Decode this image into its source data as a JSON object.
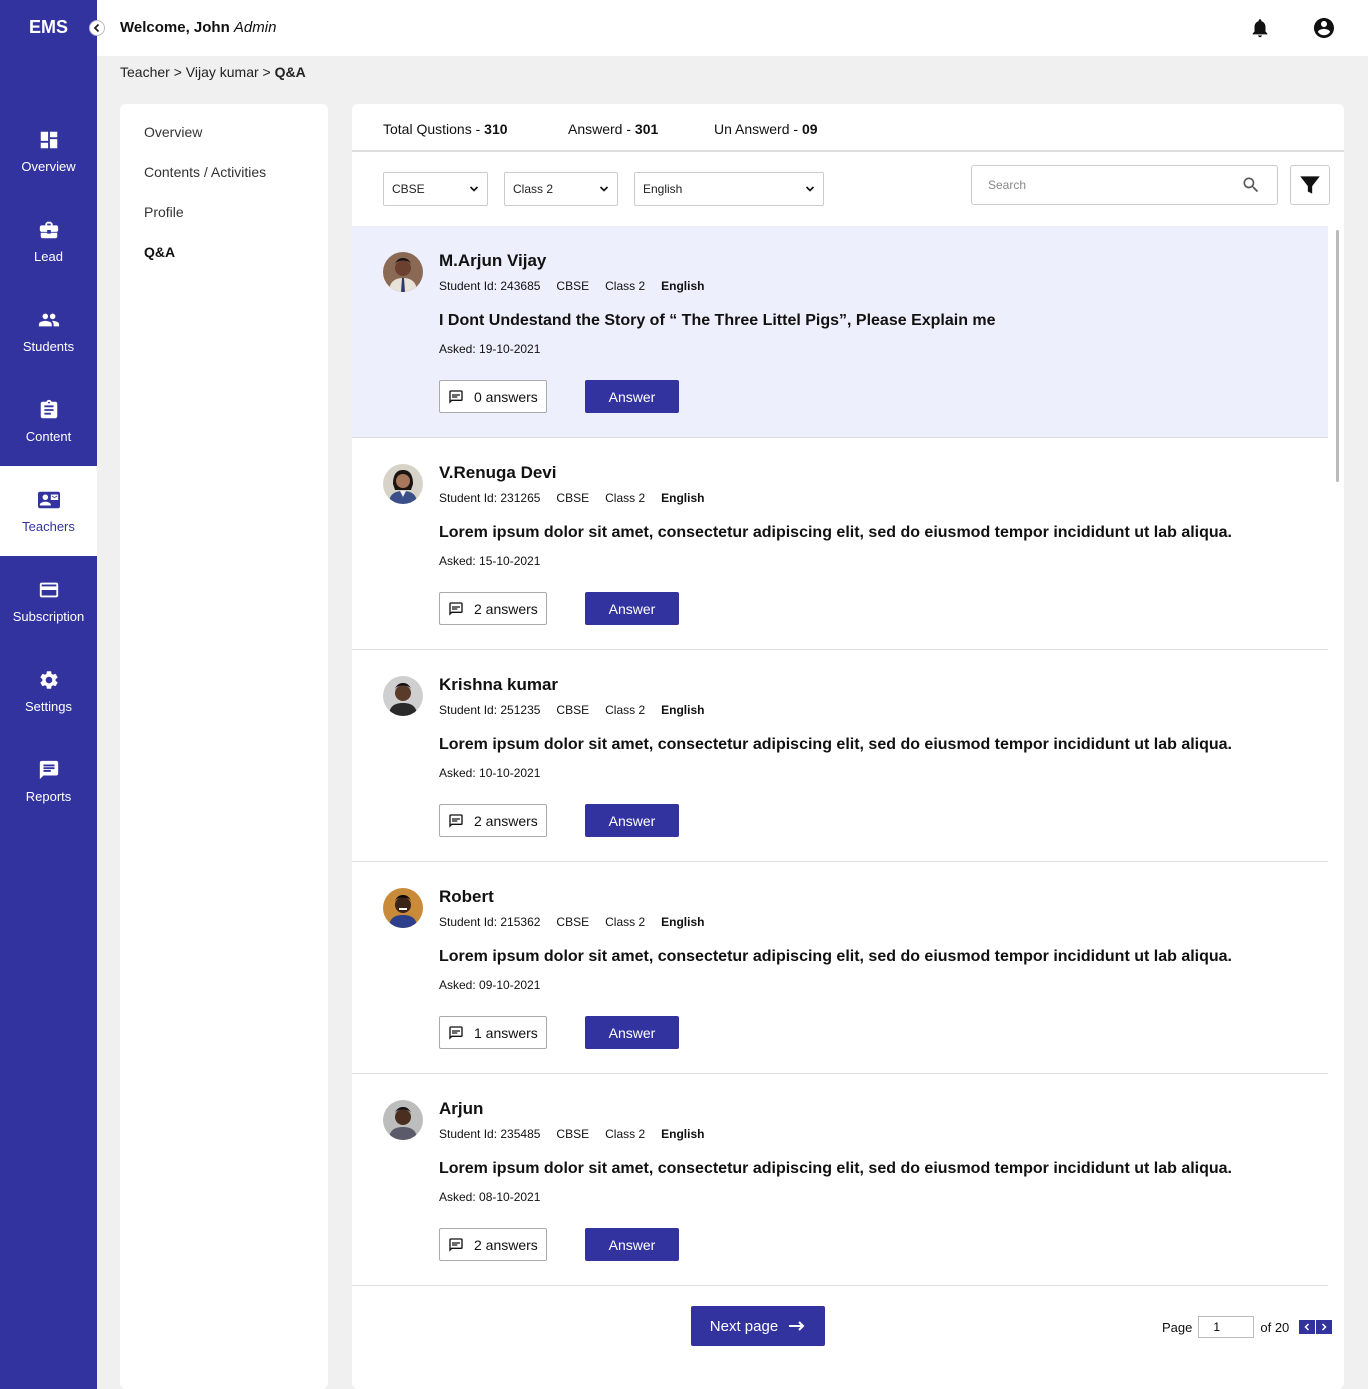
{
  "app": {
    "logo": "EMS"
  },
  "header": {
    "welcome": "Welcome, John",
    "role": "Admin"
  },
  "sidebar": {
    "items": [
      {
        "label": "Overview",
        "icon": "dashboard-icon"
      },
      {
        "label": "Lead",
        "icon": "briefcase-icon"
      },
      {
        "label": "Students",
        "icon": "people-icon"
      },
      {
        "label": "Content",
        "icon": "clipboard-icon"
      },
      {
        "label": "Teachers",
        "icon": "contact-mail-icon",
        "active": true
      },
      {
        "label": "Subscription",
        "icon": "credit-card-icon"
      },
      {
        "label": "Settings",
        "icon": "gear-icon"
      },
      {
        "label": "Reports",
        "icon": "chat-icon"
      }
    ]
  },
  "breadcrumb": {
    "teacher": "Teacher",
    "name": "Vijay kumar",
    "current": "Q&A"
  },
  "subnav": {
    "items": [
      "Overview",
      "Contents / Activities",
      "Profile",
      "Q&A"
    ]
  },
  "stats": {
    "total_label": "Total Qustions -",
    "total": "310",
    "answered_label": "Answerd -",
    "answered": "301",
    "unanswered_label": "Un Answerd -",
    "unanswered": "09"
  },
  "filters": {
    "board": "CBSE",
    "class": "Class 2",
    "subject": "English",
    "search_placeholder": "Search"
  },
  "questions": [
    {
      "name": "M.Arjun Vijay",
      "student_id": "Student Id: 243685",
      "board": "CBSE",
      "class": "Class 2",
      "subject": "English",
      "text": "I Dont Undestand the Story of “ The Three Littel Pigs”, Please Explain me",
      "asked": "Asked: 19-10-2021",
      "answers": "0 answers",
      "answer_label": "Answer"
    },
    {
      "name": "V.Renuga Devi",
      "student_id": "Student Id: 231265",
      "board": "CBSE",
      "class": "Class 2",
      "subject": "English",
      "text": "Lorem ipsum dolor sit amet, consectetur adipiscing elit, sed do eiusmod tempor incididunt ut lab aliqua.",
      "asked": "Asked: 15-10-2021",
      "answers": "2 answers",
      "answer_label": "Answer"
    },
    {
      "name": "Krishna kumar",
      "student_id": "Student Id: 251235",
      "board": "CBSE",
      "class": "Class 2",
      "subject": "English",
      "text": "Lorem ipsum dolor sit amet, consectetur adipiscing elit, sed do eiusmod tempor incididunt ut lab aliqua.",
      "asked": "Asked: 10-10-2021",
      "answers": "2 answers",
      "answer_label": "Answer"
    },
    {
      "name": "Robert",
      "student_id": "Student Id: 215362",
      "board": "CBSE",
      "class": "Class 2",
      "subject": "English",
      "text": "Lorem ipsum dolor sit amet, consectetur adipiscing elit, sed do eiusmod tempor incididunt ut lab aliqua.",
      "asked": "Asked: 09-10-2021",
      "answers": "1 answers",
      "answer_label": "Answer"
    },
    {
      "name": "Arjun",
      "student_id": "Student Id: 235485",
      "board": "CBSE",
      "class": "Class 2",
      "subject": "English",
      "text": "Lorem ipsum dolor sit amet, consectetur adipiscing elit, sed do eiusmod tempor incididunt ut lab aliqua.",
      "asked": "Asked: 08-10-2021",
      "answers": "2 answers",
      "answer_label": "Answer"
    }
  ],
  "pagination": {
    "next_label": "Next page",
    "page_label": "Page",
    "current_page": "1",
    "of_label": "of 20"
  },
  "colors": {
    "primary": "#3333a0",
    "highlight": "#eeeffc"
  }
}
